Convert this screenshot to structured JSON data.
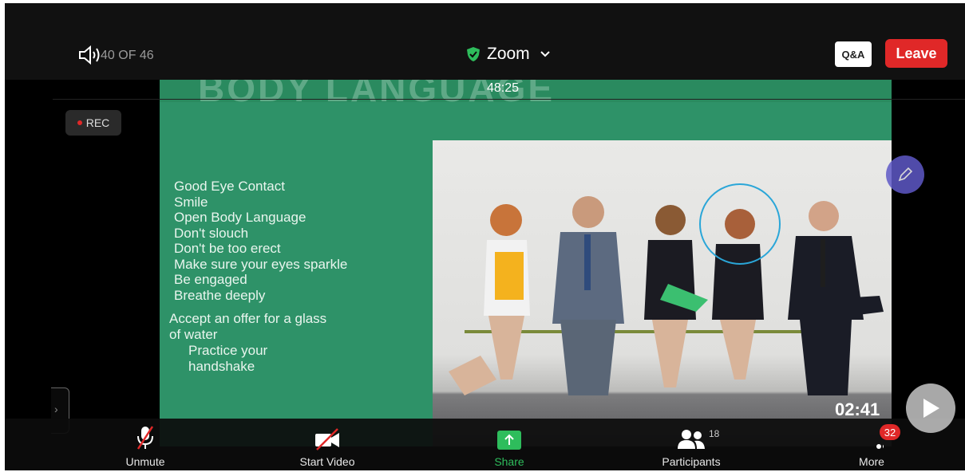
{
  "topbar": {
    "page_count": "40 OF 46",
    "title": "Zoom",
    "timer": "48:25",
    "qa_label": "Q&A",
    "leave_label": "Leave"
  },
  "recording": {
    "label": "REC"
  },
  "slide": {
    "title": "BODY LANGUAGE",
    "bullets": [
      "Good Eye Contact",
      "Smile",
      "Open Body Language",
      "Don't slouch",
      "Don't be too erect",
      "Make sure your eyes sparkle",
      "Be engaged",
      "Breathe deeply"
    ],
    "extra_lines": [
      "Accept an offer for a glass",
      "of water",
      "   Practice your",
      "   handshake"
    ]
  },
  "playback": {
    "time": "02:41"
  },
  "toolbar": {
    "unmute_label": "Unmute",
    "start_video_label": "Start Video",
    "share_label": "Share",
    "participants_label": "Participants",
    "participants_count": "18",
    "more_label": "More",
    "more_badge": "32"
  },
  "colors": {
    "leave": "#e02828",
    "share": "#2ebd5c",
    "slide_bg": "#2e9268",
    "annotate": "#5f59c7"
  },
  "icons": [
    "speaker-icon",
    "shield-icon",
    "chevron-down-icon",
    "pencil-icon",
    "play-icon",
    "mic-muted-icon",
    "video-off-icon",
    "share-arrow-icon",
    "participants-icon",
    "more-dots-icon"
  ]
}
